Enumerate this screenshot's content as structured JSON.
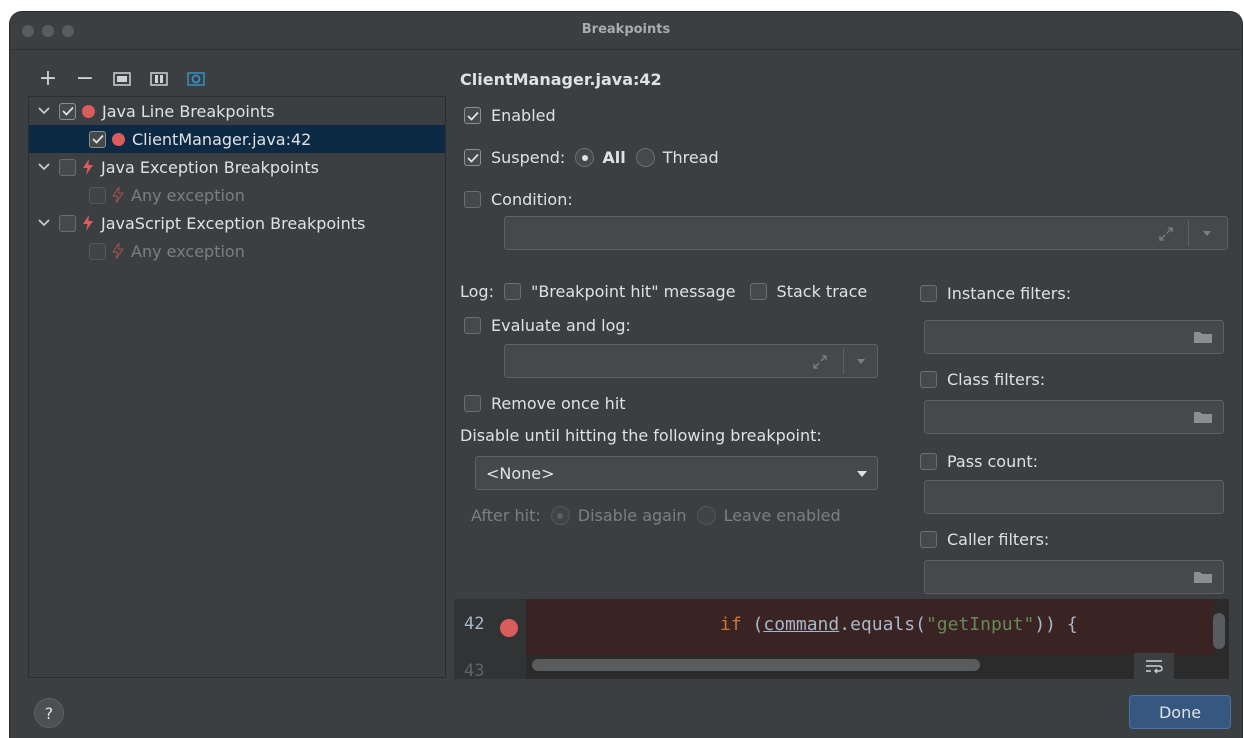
{
  "window": {
    "title": "Breakpoints"
  },
  "toolbar": {
    "add": "+",
    "remove": "−"
  },
  "tree": {
    "items": [
      {
        "label": "Java Line Breakpoints",
        "checked": true
      },
      {
        "label": "ClientManager.java:42",
        "checked": true
      },
      {
        "label": "Java Exception Breakpoints",
        "checked": false
      },
      {
        "label": "Any exception",
        "checked": false
      },
      {
        "label": "JavaScript Exception Breakpoints",
        "checked": false
      },
      {
        "label": "Any exception",
        "checked": false
      }
    ]
  },
  "detail": {
    "header": "ClientManager.java:42",
    "enabled_label": "Enabled",
    "suspend_label": "Suspend:",
    "suspend_all": "All",
    "suspend_thread": "Thread",
    "condition_label": "Condition:",
    "log_label": "Log:",
    "log_hit_message": "\"Breakpoint hit\" message",
    "log_stack_trace": "Stack trace",
    "evaluate_label": "Evaluate and log:",
    "remove_once_hit": "Remove once hit",
    "disable_until_label": "Disable until hitting the following breakpoint:",
    "disable_until_value": "<None>",
    "after_hit_label": "After hit:",
    "after_hit_disable_again": "Disable again",
    "after_hit_leave_enabled": "Leave enabled",
    "instance_filters": "Instance filters:",
    "class_filters": "Class filters:",
    "pass_count": "Pass count:",
    "caller_filters": "Caller filters:"
  },
  "code": {
    "line_number": "42",
    "next_line_number": "43",
    "keyword": "if",
    "open": " (",
    "identifier": "command",
    "method": ".equals(",
    "string": "\"getInput\"",
    "close": ")) {"
  },
  "buttons": {
    "help": "?",
    "done": "Done"
  },
  "colors": {
    "background": "#3c3f41",
    "selection": "#0d2a44",
    "breakpoint_red": "#db5c5c",
    "primary_button": "#365880"
  }
}
